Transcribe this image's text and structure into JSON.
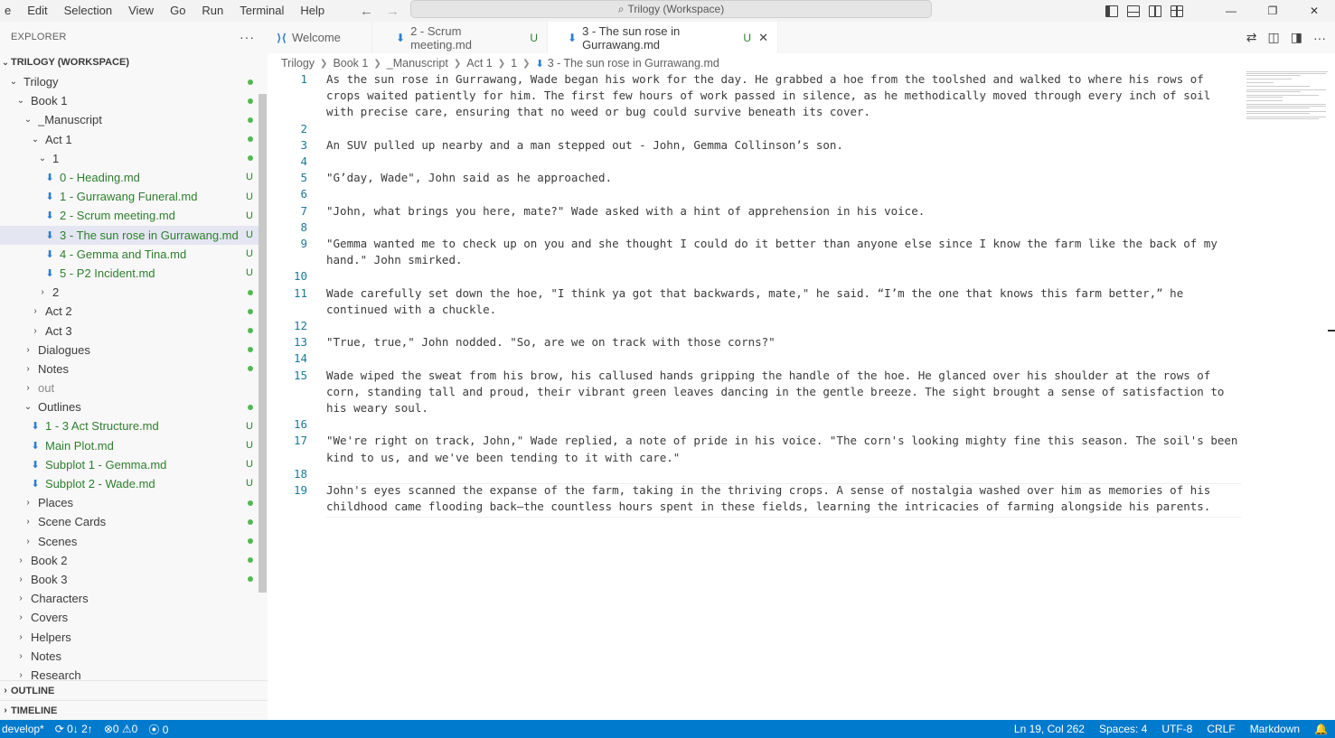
{
  "menu": [
    "e",
    "Edit",
    "Selection",
    "View",
    "Go",
    "Run",
    "Terminal",
    "Help"
  ],
  "command_center": {
    "icon": "search-icon",
    "text": "Trilogy (Workspace)"
  },
  "window_controls": {
    "minimize": "—",
    "restore": "❐",
    "close": "✕"
  },
  "sidebar": {
    "header": "EXPLORER",
    "more": "···",
    "workspace": "TRILOGY (WORKSPACE)",
    "tree": [
      {
        "label": "Trilogy",
        "depth": 0,
        "chev": "down",
        "status": "dot"
      },
      {
        "label": "Book 1",
        "depth": 1,
        "chev": "down",
        "status": "dot"
      },
      {
        "label": "_Manuscript",
        "depth": 2,
        "chev": "down",
        "status": "dot"
      },
      {
        "label": "Act 1",
        "depth": 3,
        "chev": "down",
        "status": "dot"
      },
      {
        "label": "1",
        "depth": 4,
        "chev": "down",
        "status": "dot"
      },
      {
        "label": "0 - Heading.md",
        "depth": 5,
        "file": true,
        "status": "U"
      },
      {
        "label": "1 - Gurrawang Funeral.md",
        "depth": 5,
        "file": true,
        "status": "U"
      },
      {
        "label": "2 - Scrum meeting.md",
        "depth": 5,
        "file": true,
        "status": "U"
      },
      {
        "label": "3 - The sun rose in Gurrawang.md",
        "depth": 5,
        "file": true,
        "status": "U",
        "selected": true
      },
      {
        "label": "4 - Gemma and Tina.md",
        "depth": 5,
        "file": true,
        "status": "U"
      },
      {
        "label": "5 - P2 Incident.md",
        "depth": 5,
        "file": true,
        "status": "U"
      },
      {
        "label": "2",
        "depth": 4,
        "chev": "right",
        "status": "dot"
      },
      {
        "label": "Act 2",
        "depth": 3,
        "chev": "right",
        "status": "dot"
      },
      {
        "label": "Act 3",
        "depth": 3,
        "chev": "right",
        "status": "dot"
      },
      {
        "label": "Dialogues",
        "depth": 2,
        "chev": "right",
        "status": "dot"
      },
      {
        "label": "Notes",
        "depth": 2,
        "chev": "right",
        "status": "dot"
      },
      {
        "label": "out",
        "depth": 2,
        "chev": "right",
        "dim": true
      },
      {
        "label": "Outlines",
        "depth": 2,
        "chev": "down",
        "status": "dot"
      },
      {
        "label": "1 - 3 Act Structure.md",
        "depth": 3,
        "file": true,
        "status": "U"
      },
      {
        "label": "Main Plot.md",
        "depth": 3,
        "file": true,
        "status": "U"
      },
      {
        "label": "Subplot 1 - Gemma.md",
        "depth": 3,
        "file": true,
        "status": "U"
      },
      {
        "label": "Subplot 2 - Wade.md",
        "depth": 3,
        "file": true,
        "status": "U"
      },
      {
        "label": "Places",
        "depth": 2,
        "chev": "right",
        "status": "dot"
      },
      {
        "label": "Scene Cards",
        "depth": 2,
        "chev": "right",
        "status": "dot"
      },
      {
        "label": "Scenes",
        "depth": 2,
        "chev": "right",
        "status": "dot"
      },
      {
        "label": "Book 2",
        "depth": 1,
        "chev": "right",
        "status": "dot"
      },
      {
        "label": "Book 3",
        "depth": 1,
        "chev": "right",
        "status": "dot"
      },
      {
        "label": "Characters",
        "depth": 1,
        "chev": "right"
      },
      {
        "label": "Covers",
        "depth": 1,
        "chev": "right"
      },
      {
        "label": "Helpers",
        "depth": 1,
        "chev": "right"
      },
      {
        "label": "Notes",
        "depth": 1,
        "chev": "right"
      },
      {
        "label": "Research",
        "depth": 1,
        "chev": "right"
      }
    ],
    "outline": "OUTLINE",
    "timeline": "TIMELINE"
  },
  "tabs": [
    {
      "label": "Welcome",
      "icon": "vscode-icon",
      "u": "",
      "active": false
    },
    {
      "label": "2 - Scrum meeting.md",
      "icon": "pin-icon",
      "u": "U",
      "active": false
    },
    {
      "label": "3 - The sun rose in Gurrawang.md",
      "icon": "pin-icon",
      "u": "U",
      "active": true
    }
  ],
  "breadcrumb": [
    "Trilogy",
    "Book 1",
    "_Manuscript",
    "Act 1",
    "1",
    "3 - The sun rose in Gurrawang.md"
  ],
  "editor": {
    "lines": [
      {
        "n": "1",
        "text": "As the sun rose in Gurrawang, Wade began his work for the day. He grabbed a hoe from the toolshed and walked to where his rows of crops waited patiently for him. The first few hours of work passed in silence, as he methodically moved through every inch of soil with precise care, ensuring that no weed or bug could survive beneath its cover."
      },
      {
        "n": "2",
        "text": ""
      },
      {
        "n": "3",
        "text": "An SUV pulled up nearby and a man stepped out - John, Gemma Collinson’s son."
      },
      {
        "n": "4",
        "text": ""
      },
      {
        "n": "5",
        "text": "\"G’day, Wade\", John said as he approached."
      },
      {
        "n": "6",
        "text": ""
      },
      {
        "n": "7",
        "text": "\"John, what brings you here, mate?\" Wade asked with a hint of apprehension in his voice."
      },
      {
        "n": "8",
        "text": ""
      },
      {
        "n": "9",
        "text": "\"Gemma wanted me to check up on you and she thought I could do it better than anyone else since I know the farm like the back of my hand.\" John smirked."
      },
      {
        "n": "10",
        "text": ""
      },
      {
        "n": "11",
        "text": "Wade carefully set down the hoe, \"I think ya got that backwards, mate,\" he said. “I’m the one that knows this farm better,” he continued with a chuckle."
      },
      {
        "n": "12",
        "text": ""
      },
      {
        "n": "13",
        "text": "\"True, true,\" John nodded. \"So, are we on track with those corns?\""
      },
      {
        "n": "14",
        "text": ""
      },
      {
        "n": "15",
        "text": "Wade wiped the sweat from his brow, his callused hands gripping the handle of the hoe. He glanced over his shoulder at the rows of corn, standing tall and proud, their vibrant green leaves dancing in the gentle breeze. The sight brought a sense of satisfaction to his weary soul."
      },
      {
        "n": "16",
        "text": ""
      },
      {
        "n": "17",
        "text": "\"We're right on track, John,\" Wade replied, a note of pride in his voice. \"The corn's looking mighty fine this season. The soil's been kind to us, and we've been tending to it with care.\""
      },
      {
        "n": "18",
        "text": ""
      },
      {
        "n": "19",
        "text": "John's eyes scanned the expanse of the farm, taking in the thriving crops. A sense of nostalgia washed over him as memories of his childhood came flooding back—the countless hours spent in these fields, learning the intricacies of farming alongside his parents."
      }
    ]
  },
  "statusbar": {
    "branch": "develop*",
    "sync": "0↓ 2↑",
    "errors": "0",
    "warnings": "0",
    "ports": "0",
    "position": "Ln 19, Col 262",
    "spaces": "Spaces: 4",
    "encoding": "UTF-8",
    "eol": "CRLF",
    "language": "Markdown"
  },
  "colors": {
    "accent": "#007acc",
    "git_green": "#2f7e2f",
    "selection": "#e4e6f1",
    "line_number": "#237893"
  }
}
